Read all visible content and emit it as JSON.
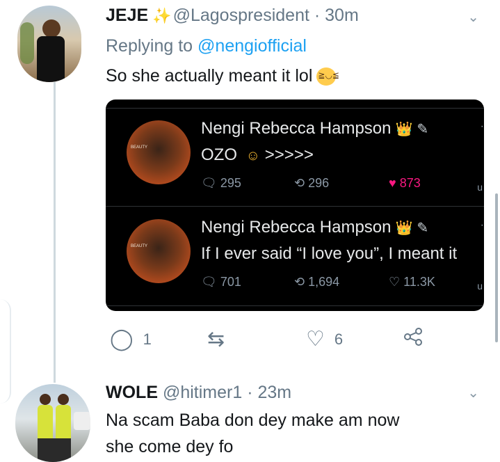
{
  "tweet1": {
    "name": "JEJE",
    "sparkle": "✨",
    "handle": "@Lagospresident",
    "dot": "·",
    "time": "30m",
    "replying_prefix": "Replying to",
    "replying_mention": "@nengiofficial",
    "text": "So she actually meant it lol",
    "emoji": "laughing-cat-emoji",
    "chevron": "⌄",
    "actions": {
      "reply_count": "1",
      "retweet_count": "",
      "like_count": "6"
    }
  },
  "embed": {
    "tweets": [
      {
        "name": "Nengi Rebecca Hampson",
        "crown": "👑",
        "pencil": "✎",
        "text": "OZO",
        "text_suffix": ">>>>>",
        "reply_count": "295",
        "retweet_count": "296",
        "like_count": "873",
        "avatar_text": "BEAUTY"
      },
      {
        "name": "Nengi Rebecca Hampson",
        "crown": "👑",
        "pencil": "✎",
        "text": "If I ever said “I love you”, I meant it",
        "reply_count": "701",
        "retweet_count": "1,694",
        "like_count": "11.3K",
        "avatar_text": "BEAUTY"
      }
    ]
  },
  "tweet2": {
    "name": "WOLE",
    "handle": "@hitimer1",
    "dot": "·",
    "time": "23m",
    "chevron": "⌄",
    "text_line1": "Na scam Baba don dey make am now",
    "text_line2": "she come dey fo"
  },
  "colors": {
    "accent": "#1da1f2",
    "like_red": "#f91880",
    "muted": "#657786"
  }
}
